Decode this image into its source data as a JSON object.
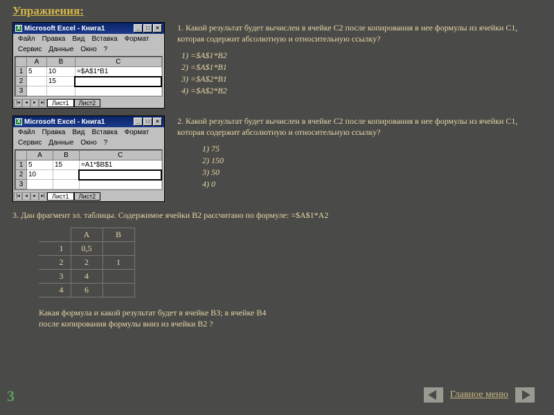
{
  "title": "Упражнения:",
  "excel": {
    "app_title": "Microsoft Excel - Книга1",
    "menu": [
      "Файл",
      "Правка",
      "Вид",
      "Вставка",
      "Формат",
      "Сервис",
      "Данные",
      "Окно",
      "?"
    ],
    "sheet_tabs": [
      "Лист1",
      "Лист2"
    ],
    "win1": {
      "cols": [
        "A",
        "B",
        "C"
      ],
      "rows": [
        [
          "5",
          "10",
          "=$A$1*B1"
        ],
        [
          "",
          "15",
          ""
        ],
        [
          "",
          "",
          ""
        ]
      ]
    },
    "win2": {
      "cols": [
        "A",
        "B",
        "C"
      ],
      "rows": [
        [
          "5",
          "15",
          "=A1*$B$1"
        ],
        [
          "10",
          "",
          ""
        ],
        [
          "",
          "",
          ""
        ]
      ]
    }
  },
  "q1": {
    "text": "1. Какой результат будет вычислен в ячейке С2 после копирования в нее формулы из ячейки С1, которая содержит абсолютную и относительную ссылку?",
    "answers": [
      "1)   =$A$1*B2",
      "2)   =$A$1*B1",
      "3)   =$A$2*B1",
      "4)   =$A$2*B2"
    ]
  },
  "q2": {
    "text": "2. Какой результат будет вычислен в ячейке С2 после копирования в нее формулы из ячейки С1, которая содержит абсолютную и относительную ссылку?",
    "answers": [
      "1)   75",
      "2)  150",
      "3)  50",
      "4)  0"
    ]
  },
  "q3": {
    "text": "3. Дан фрагмент эл. таблицы. Содержимое ячейки В2 рассчитано по формуле: =$A$1*A2",
    "table": {
      "cols": [
        "A",
        "B"
      ],
      "rows": [
        [
          "1",
          "0,5",
          ""
        ],
        [
          "2",
          "2",
          "1"
        ],
        [
          "3",
          "4",
          ""
        ],
        [
          "4",
          "6",
          ""
        ]
      ]
    },
    "follow": "Какая формула и какой результат будет в ячейке В3; в ячейке В4\nпосле копирования формулы вниз из ячейки В2 ?"
  },
  "footer": {
    "page": "3",
    "menu": "Главное меню"
  }
}
